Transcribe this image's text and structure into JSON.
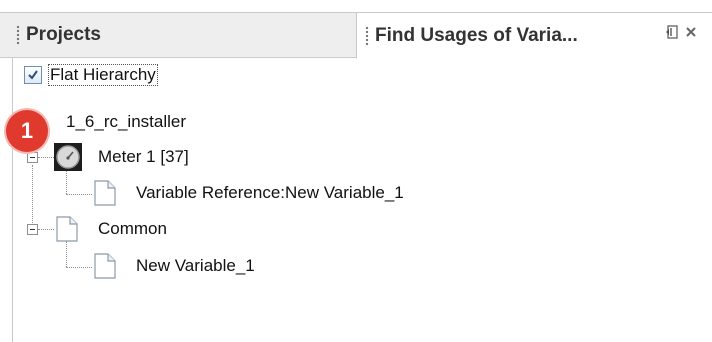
{
  "tabs": {
    "projects": {
      "label": "Projects"
    },
    "find_usages": {
      "label": "Find Usages of Varia..."
    }
  },
  "flat_hierarchy": {
    "label": "Flat Hierarchy",
    "checked": true
  },
  "tree": {
    "root": {
      "label": "1_6_rc_installer"
    },
    "meter": {
      "label": "Meter 1 [37]"
    },
    "variable_reference": {
      "label": "Variable Reference:New Variable_1"
    },
    "common": {
      "label": "Common"
    },
    "new_variable": {
      "label": "New Variable_1"
    }
  },
  "annotation": {
    "badge_number": "1",
    "color": "#e03a2f"
  }
}
